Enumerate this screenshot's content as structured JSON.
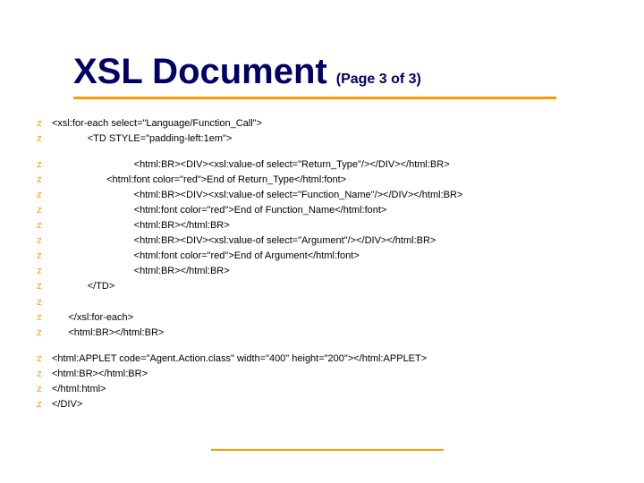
{
  "title": "XSL Document",
  "pageIndicator": "(Page 3 of 3)",
  "bullet": "z",
  "lines": [
    "<xsl:for-each select=\"Language/Function_Call\">",
    "             <TD STYLE=\"padding-left:1em\">",
    "",
    "                              <html:BR><DIV><xsl:value-of select=\"Return_Type\"/></DIV></html:BR>",
    "                    <html:font color=\"red\">End of Return_Type</html:font>",
    "                              <html:BR><DIV><xsl:value-of select=\"Function_Name\"/></DIV></html:BR>",
    "                              <html:font color=\"red\">End of Function_Name</html:font>",
    "                              <html:BR></html:BR>",
    "                              <html:BR><DIV><xsl:value-of select=\"Argument\"/></DIV></html:BR>",
    "                              <html:font color=\"red\">End of Argument</html:font>",
    "                              <html:BR></html:BR>",
    "             </TD>",
    " ",
    "      </xsl:for-each>",
    "      <html:BR></html:BR>",
    "",
    "<html:APPLET code=\"Agent.Action.class\" width=\"400\" height=\"200\"></html:APPLET>",
    "<html:BR></html:BR>",
    "</html:html>",
    "</DIV>"
  ]
}
